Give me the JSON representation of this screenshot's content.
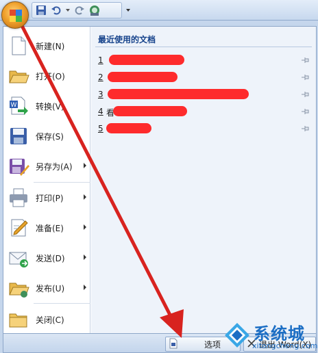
{
  "colors": {
    "accent": "#15428b",
    "redaction": "#ff1a1a",
    "annotation_arrow": "#d8231f",
    "watermark": "#1c6ec4"
  },
  "quick_access": {
    "icons": [
      "save-icon",
      "undo-icon",
      "redo-icon",
      "print-preview-icon",
      "customize-dropdown-icon"
    ]
  },
  "menu": {
    "items": [
      {
        "label": "新建(N)",
        "icon": "new-document-icon",
        "submenu": false
      },
      {
        "label": "打开(O)",
        "icon": "open-folder-icon",
        "submenu": false
      },
      {
        "label": "转换(V)",
        "icon": "convert-icon",
        "submenu": false
      },
      {
        "label": "保存(S)",
        "icon": "save-icon",
        "submenu": false
      },
      {
        "label": "另存为(A)",
        "icon": "save-as-icon",
        "submenu": true
      },
      {
        "label": "打印(P)",
        "icon": "printer-icon",
        "submenu": true
      },
      {
        "label": "准备(E)",
        "icon": "prepare-icon",
        "submenu": true
      },
      {
        "label": "发送(D)",
        "icon": "send-icon",
        "submenu": true
      },
      {
        "label": "发布(U)",
        "icon": "publish-icon",
        "submenu": true
      },
      {
        "label": "关闭(C)",
        "icon": "close-folder-icon",
        "submenu": false
      }
    ]
  },
  "recent": {
    "title": "最近使用的文档",
    "documents": [
      {
        "number": "1",
        "name": ""
      },
      {
        "number": "2",
        "name": ""
      },
      {
        "number": "3",
        "name": ""
      },
      {
        "number": "4",
        "name": "看"
      },
      {
        "number": "5",
        "name": ""
      }
    ]
  },
  "bottom": {
    "options_label": "选项",
    "exit_label": "退出 Word(X)"
  },
  "watermark": {
    "name": "系统城",
    "url": "xitongcheng.com"
  }
}
